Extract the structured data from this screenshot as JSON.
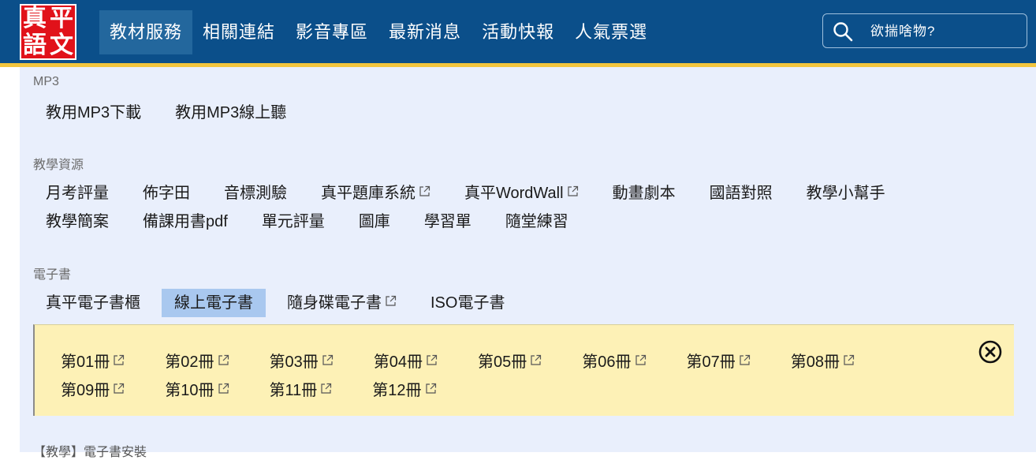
{
  "logo": {
    "chars": [
      "真",
      "平",
      "語",
      "文"
    ]
  },
  "nav": {
    "items": [
      {
        "label": "教材服務",
        "active": true
      },
      {
        "label": "相關連結"
      },
      {
        "label": "影音專區"
      },
      {
        "label": "最新消息"
      },
      {
        "label": "活動快報"
      },
      {
        "label": "人氣票選"
      }
    ]
  },
  "search": {
    "placeholder": "欲揣啥物?"
  },
  "sections": {
    "mp3": {
      "title": "MP3",
      "links": [
        "教用MP3下載",
        "教用MP3線上聽"
      ]
    },
    "teaching": {
      "title": "教學資源",
      "row1": [
        {
          "label": "月考評量"
        },
        {
          "label": "佈字田"
        },
        {
          "label": "音標測驗"
        },
        {
          "label": "真平題庫系統",
          "external": true
        },
        {
          "label": "真平WordWall",
          "external": true
        },
        {
          "label": "動畫劇本"
        },
        {
          "label": "國語對照"
        },
        {
          "label": "教學小幫手"
        }
      ],
      "row2": [
        {
          "label": "教學簡案"
        },
        {
          "label": "備課用書pdf"
        },
        {
          "label": "單元評量"
        },
        {
          "label": "圖庫"
        },
        {
          "label": "學習單"
        },
        {
          "label": "隨堂練習"
        }
      ]
    },
    "ebook": {
      "title": "電子書",
      "links": [
        {
          "label": "真平電子書櫃"
        },
        {
          "label": "線上電子書",
          "selected": true
        },
        {
          "label": "隨身碟電子書",
          "external": true
        },
        {
          "label": "ISO電子書"
        }
      ],
      "volumes_row1": [
        "第01冊",
        "第02冊",
        "第03冊",
        "第04冊",
        "第05冊",
        "第06冊",
        "第07冊",
        "第08冊"
      ],
      "volumes_row2": [
        "第09冊",
        "第10冊",
        "第11冊",
        "第12冊"
      ]
    },
    "next_title_partial": "【教學】電子書安裝"
  },
  "colors": {
    "header_bg": "#0b4f8a",
    "accent_bar": "#f2c53d",
    "panel_bg": "#e9effc",
    "subpanel_bg": "#fdf1b6",
    "selected_bg": "#a9c8ef"
  }
}
